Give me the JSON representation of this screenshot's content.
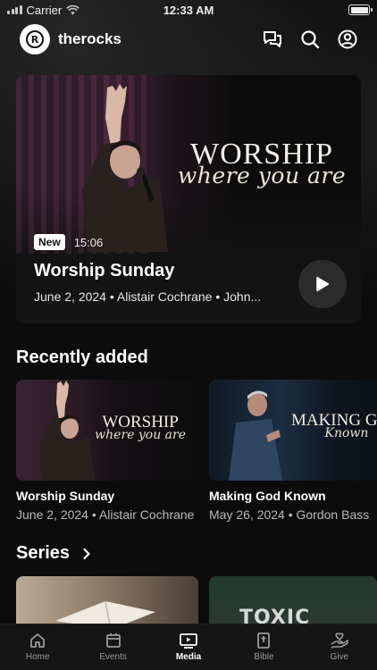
{
  "status_bar": {
    "carrier": "Carrier",
    "time": "12:33 AM"
  },
  "header": {
    "brand": "therocks",
    "logo_letter": "R"
  },
  "hero": {
    "art_title": "WORSHIP",
    "art_script": "where you are",
    "badge": "New",
    "duration": "15:06",
    "title": "Worship Sunday",
    "subtitle": "June 2, 2024 • Alistair Cochrane • John..."
  },
  "sections": {
    "recent": "Recently added",
    "series": "Series"
  },
  "recent": [
    {
      "title": "Worship Sunday",
      "subtitle": "June 2, 2024 • Alistair Cochrane",
      "art_title": "WORSHIP",
      "art_script": "where you are"
    },
    {
      "title": "Making God Known",
      "subtitle": "May 26, 2024 • Gordon Bass",
      "art_title": "MAKING GOD",
      "art_script": "Known"
    }
  ],
  "series": [
    {
      "art_text": ""
    },
    {
      "art_text": "TOXIC FAITH"
    }
  ],
  "tabs": [
    {
      "label": "Home",
      "icon": "home-icon"
    },
    {
      "label": "Events",
      "icon": "calendar-icon"
    },
    {
      "label": "Media",
      "icon": "play-screen-icon",
      "active": true
    },
    {
      "label": "Bible",
      "icon": "bible-icon"
    },
    {
      "label": "Give",
      "icon": "give-icon"
    }
  ],
  "colors": {
    "background": "#0c0c0c",
    "tab_bar": "#151515",
    "active_tab": "#ffffff",
    "inactive_tab": "#9a9a9a"
  }
}
